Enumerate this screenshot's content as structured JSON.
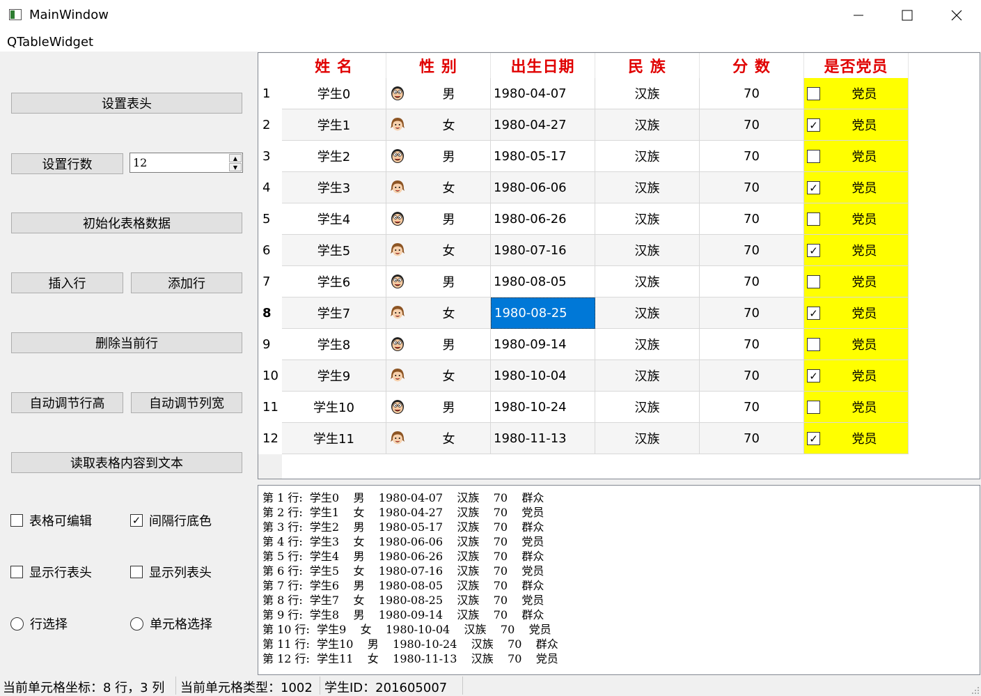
{
  "window": {
    "title": "MainWindow"
  },
  "menu": {
    "item": "QTableWidget"
  },
  "left": {
    "btn_header": "设置表头",
    "btn_rowcount": "设置行数",
    "rowcount_value": "12",
    "btn_init": "初始化表格数据",
    "btn_insert": "插入行",
    "btn_append": "添加行",
    "btn_delete": "删除当前行",
    "btn_autoheight": "自动调节行高",
    "btn_autowidth": "自动调节列宽",
    "btn_read": "读取表格内容到文本",
    "chk_editable": "表格可编辑",
    "chk_altrows": "间隔行底色",
    "chk_rowheader": "显示行表头",
    "chk_colheader": "显示列表头",
    "radio_row": "行选择",
    "radio_cell": "单元格选择"
  },
  "table": {
    "headers": [
      "姓 名",
      "性 别",
      "出生日期",
      "民 族",
      "分 数",
      "是否党员"
    ],
    "rows": [
      {
        "num": "1",
        "name": "学生0",
        "sex": "男",
        "birth": "1980-04-07",
        "nation": "汉族",
        "score": "70",
        "party": "党员",
        "checked": false
      },
      {
        "num": "2",
        "name": "学生1",
        "sex": "女",
        "birth": "1980-04-27",
        "nation": "汉族",
        "score": "70",
        "party": "党员",
        "checked": true
      },
      {
        "num": "3",
        "name": "学生2",
        "sex": "男",
        "birth": "1980-05-17",
        "nation": "汉族",
        "score": "70",
        "party": "党员",
        "checked": false
      },
      {
        "num": "4",
        "name": "学生3",
        "sex": "女",
        "birth": "1980-06-06",
        "nation": "汉族",
        "score": "70",
        "party": "党员",
        "checked": true
      },
      {
        "num": "5",
        "name": "学生4",
        "sex": "男",
        "birth": "1980-06-26",
        "nation": "汉族",
        "score": "70",
        "party": "党员",
        "checked": false
      },
      {
        "num": "6",
        "name": "学生5",
        "sex": "女",
        "birth": "1980-07-16",
        "nation": "汉族",
        "score": "70",
        "party": "党员",
        "checked": true
      },
      {
        "num": "7",
        "name": "学生6",
        "sex": "男",
        "birth": "1980-08-05",
        "nation": "汉族",
        "score": "70",
        "party": "党员",
        "checked": false
      },
      {
        "num": "8",
        "name": "学生7",
        "sex": "女",
        "birth": "1980-08-25",
        "nation": "汉族",
        "score": "70",
        "party": "党员",
        "checked": true
      },
      {
        "num": "9",
        "name": "学生8",
        "sex": "男",
        "birth": "1980-09-14",
        "nation": "汉族",
        "score": "70",
        "party": "党员",
        "checked": false
      },
      {
        "num": "10",
        "name": "学生9",
        "sex": "女",
        "birth": "1980-10-04",
        "nation": "汉族",
        "score": "70",
        "party": "党员",
        "checked": true
      },
      {
        "num": "11",
        "name": "学生10",
        "sex": "男",
        "birth": "1980-10-24",
        "nation": "汉族",
        "score": "70",
        "party": "党员",
        "checked": false
      },
      {
        "num": "12",
        "name": "学生11",
        "sex": "女",
        "birth": "1980-11-13",
        "nation": "汉族",
        "score": "70",
        "party": "党员",
        "checked": true
      }
    ],
    "selected_row": 8,
    "highlight_color": "#ffff00",
    "selection_color": "#0078d7",
    "header_color": "#e00000"
  },
  "text": {
    "lines": [
      "第 1 行:  学生0    男    1980-04-07    汉族    70    群众",
      "第 2 行:  学生1    女    1980-04-27    汉族    70    党员",
      "第 3 行:  学生2    男    1980-05-17    汉族    70    群众",
      "第 4 行:  学生3    女    1980-06-06    汉族    70    党员",
      "第 5 行:  学生4    男    1980-06-26    汉族    70    群众",
      "第 6 行:  学生5    女    1980-07-16    汉族    70    党员",
      "第 7 行:  学生6    男    1980-08-05    汉族    70    群众",
      "第 8 行:  学生7    女    1980-08-25    汉族    70    党员",
      "第 9 行:  学生8    男    1980-09-14    汉族    70    群众",
      "第 10 行:  学生9    女    1980-10-04    汉族    70    党员",
      "第 11 行:  学生10    男    1980-10-24    汉族    70    群众",
      "第 12 行:  学生11    女    1980-11-13    汉族    70    党员"
    ]
  },
  "status": {
    "coord": "当前单元格坐标：8 行，3 列",
    "type": "当前单元格类型：1002",
    "id": "学生ID：201605007"
  }
}
